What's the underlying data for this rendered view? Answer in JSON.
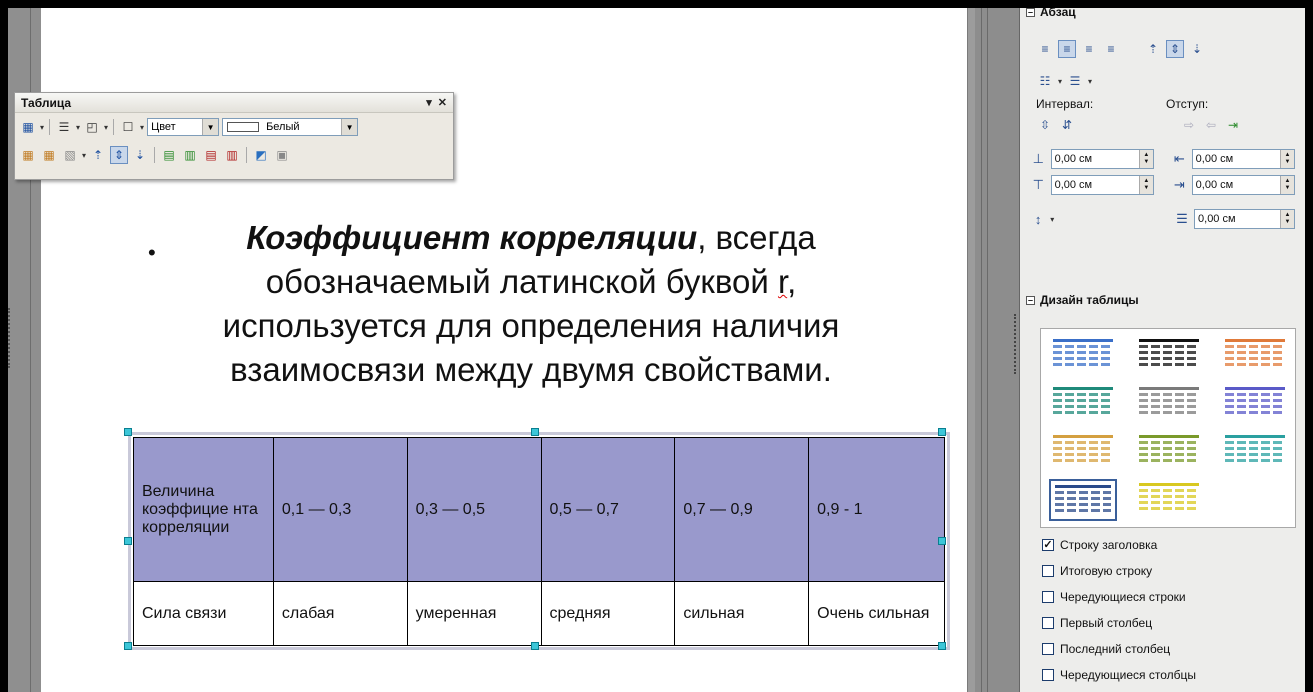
{
  "toolbar": {
    "title": "Таблица",
    "menu_glyph": "▾",
    "close_glyph": "✕",
    "border_color_label": "Цвет",
    "fill_color_label": "Белый"
  },
  "slide": {
    "bullet": "•",
    "term": "Коэффициент корреляции",
    "after_term": ", всегда",
    "line2_before": "обозначаемый латинской буквой ",
    "line2_letter": "r",
    "line2_after": ",",
    "line3": "используется для определения наличия",
    "line4": "взаимосвязи между двумя свойствами."
  },
  "table": {
    "header": [
      "Величина коэффицие нта корреляции",
      "0,1 — 0,3",
      "0,3 — 0,5",
      "0,5 — 0,7",
      "0,7 — 0,9",
      "0,9 - 1"
    ],
    "row": [
      "Сила связи",
      "слабая",
      "умеренная",
      "средняя",
      "сильная",
      "Очень сильная"
    ]
  },
  "sidebar": {
    "paragraph_title": "Абзац",
    "interval_label": "Интервал:",
    "indent_label": "Отступ:",
    "spacing_above": "0,00 см",
    "spacing_below": "0,00 см",
    "indent_before": "0,00 см",
    "indent_after": "0,00 см",
    "first_line": "0,00 см",
    "table_design_title": "Дизайн таблицы",
    "checks": [
      {
        "label": "Строку заголовка",
        "checked": true
      },
      {
        "label": "Итоговую строку",
        "checked": false
      },
      {
        "label": "Чередующиеся строки",
        "checked": false
      },
      {
        "label": "Первый столбец",
        "checked": false
      },
      {
        "label": "Последний столбец",
        "checked": false
      },
      {
        "label": "Чередующиеся столбцы",
        "checked": false
      }
    ]
  },
  "colors": {
    "table_header_fill": "#9999cc",
    "selection_handle": "#3cc6d8",
    "gallery_styles": [
      "#3a6fc8",
      "#111111",
      "#e07a3a",
      "#1f8a7a",
      "#7a7a7a",
      "#5a5ac8",
      "#d4a040",
      "#7a9a2a",
      "#2aa0a0",
      "#2a4a8a",
      "#d8c820"
    ]
  }
}
